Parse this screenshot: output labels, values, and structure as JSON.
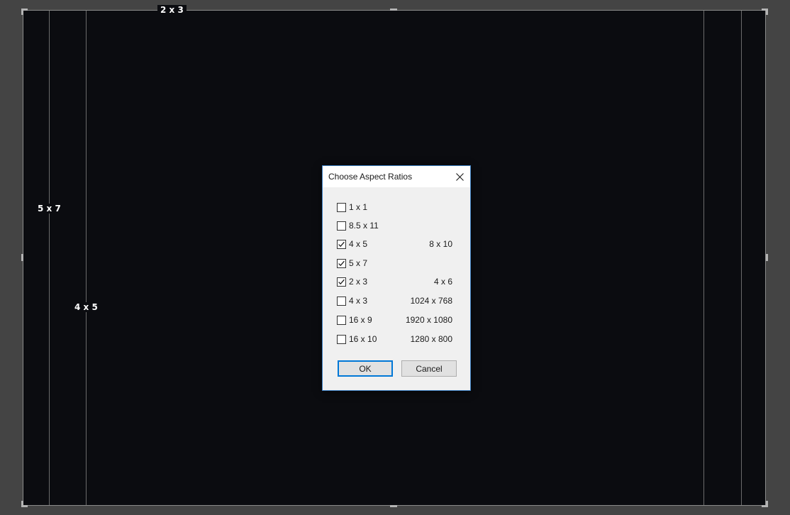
{
  "guides": {
    "top_label": "2 x 3",
    "left_label_outer": "5 x 7",
    "left_label_inner": "4 x 5"
  },
  "dialog": {
    "title": "Choose Aspect Ratios",
    "close_icon": "close-icon",
    "options": [
      {
        "label": "1 x 1",
        "size": "",
        "checked": false
      },
      {
        "label": "8.5 x 11",
        "size": "",
        "checked": false
      },
      {
        "label": "4 x 5",
        "size": "8 x 10",
        "checked": true
      },
      {
        "label": "5 x 7",
        "size": "",
        "checked": true
      },
      {
        "label": "2 x 3",
        "size": "4 x 6",
        "checked": true
      },
      {
        "label": "4 x 3",
        "size": "1024 x 768",
        "checked": false
      },
      {
        "label": "16 x 9",
        "size": "1920 x 1080",
        "checked": false
      },
      {
        "label": "16 x 10",
        "size": "1280 x 800",
        "checked": false
      }
    ],
    "ok_label": "OK",
    "cancel_label": "Cancel"
  },
  "colors": {
    "workspace": "#444444",
    "canvas": "#0b0c10",
    "accent": "#0078d7"
  }
}
